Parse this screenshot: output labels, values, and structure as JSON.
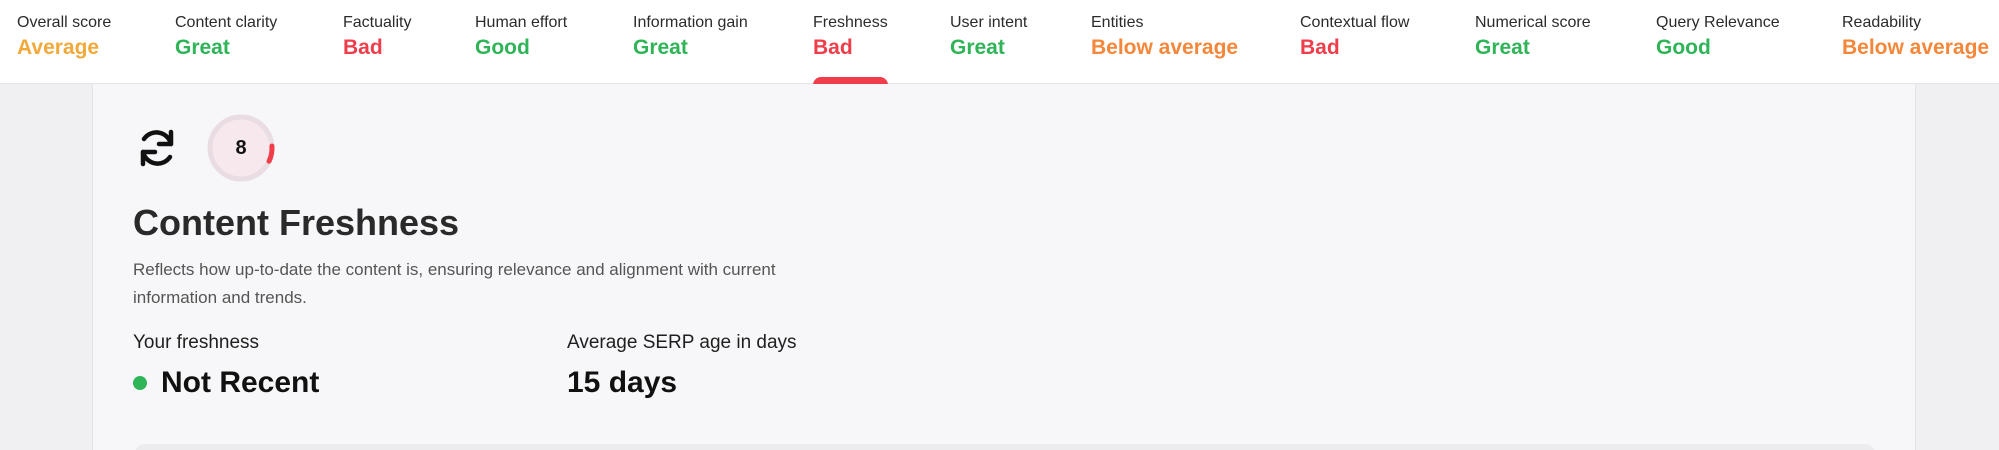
{
  "tabs": [
    {
      "label": "Overall score",
      "value": "Average"
    },
    {
      "label": "Content clarity",
      "value": "Great"
    },
    {
      "label": "Factuality",
      "value": "Bad"
    },
    {
      "label": "Human effort",
      "value": "Good"
    },
    {
      "label": "Information gain",
      "value": "Great"
    },
    {
      "label": "Freshness",
      "value": "Bad",
      "active": true
    },
    {
      "label": "User intent",
      "value": "Great"
    },
    {
      "label": "Entities",
      "value": "Below average"
    },
    {
      "label": "Contextual flow",
      "value": "Bad"
    },
    {
      "label": "Numerical score",
      "value": "Great"
    },
    {
      "label": "Query Relevance",
      "value": "Good"
    },
    {
      "label": "Readability",
      "value": "Below average"
    }
  ],
  "colors": {
    "average": "#f2a93b",
    "great": "#2fb457",
    "good": "#2fb457",
    "bad": "#ef3e4a",
    "below_average": "#f5873a"
  },
  "panel": {
    "icon": "refresh-icon",
    "score": "8",
    "score_fraction": 0.08,
    "title": "Content Freshness",
    "description": "Reflects how up-to-date the content is, ensuring relevance and alignment with current information and trends.",
    "your_freshness_label": "Your freshness",
    "your_freshness_value": "Not Recent",
    "serp_age_label": "Average SERP age in days",
    "serp_age_value": "15 days"
  }
}
